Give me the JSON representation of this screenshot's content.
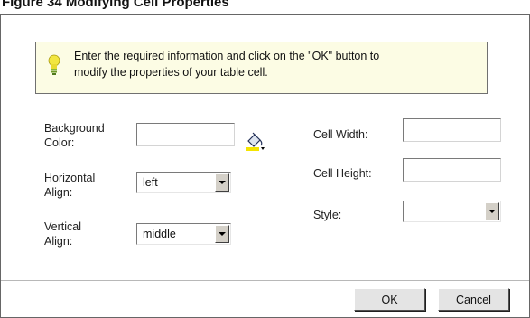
{
  "figure": {
    "caption": "Figure 34   Modifying Cell Properties"
  },
  "info": {
    "message_line1": "Enter the required information and click on the \"OK\" button to",
    "message_line2": "modify the properties of your table cell.",
    "icon": "lightbulb-icon"
  },
  "form": {
    "background_color": {
      "label_line1": "Background",
      "label_line2": "Color:",
      "value": "",
      "picker_icon": "paint-bucket-icon"
    },
    "horizontal_align": {
      "label_line1": "Horizontal",
      "label_line2": "Align:",
      "value": "left"
    },
    "vertical_align": {
      "label_line1": "Vertical",
      "label_line2": "Align:",
      "value": "middle"
    },
    "cell_width": {
      "label": "Cell Width:",
      "value": ""
    },
    "cell_height": {
      "label": "Cell Height:",
      "value": ""
    },
    "style": {
      "label": "Style:",
      "value": ""
    }
  },
  "buttons": {
    "ok": "OK",
    "cancel": "Cancel"
  },
  "colors": {
    "info_background": "#fcfce4",
    "button_face": "#e4e4e4",
    "bulb": "#f2e640",
    "picker_color_bar": "#f4e400"
  }
}
